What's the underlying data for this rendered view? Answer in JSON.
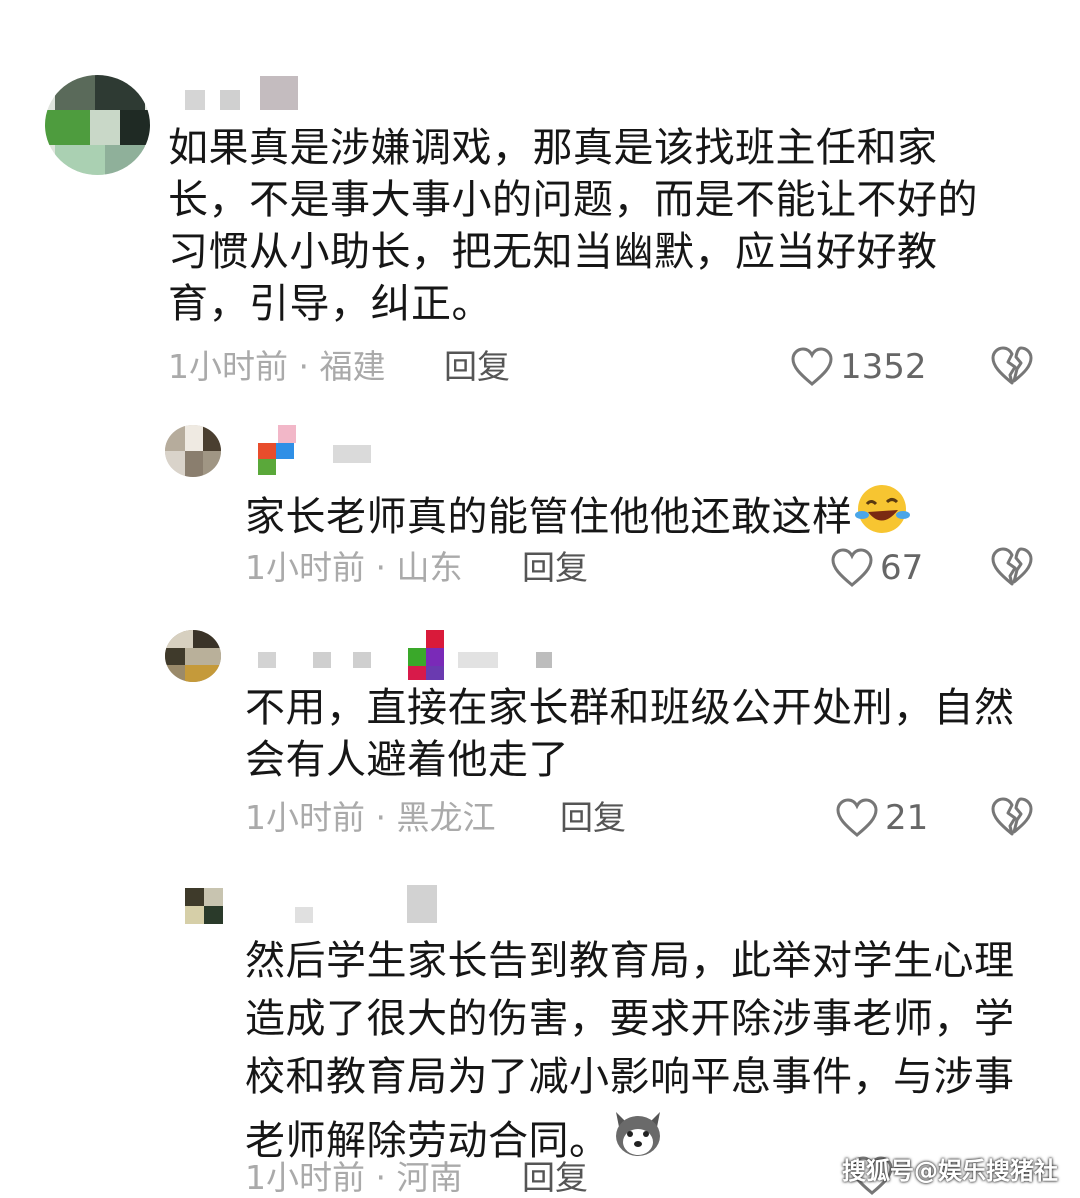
{
  "comments": [
    {
      "text": "如果真是涉嫌调戏，那真是该找班主任和家长，不是事大事小的问题，而是不能让不好的习惯从小助长，把无知当幽默，应当好好教育，引导，纠正。",
      "meta": "1小时前 · 福建",
      "reply": "回复",
      "likes": "1352"
    },
    {
      "text": "家长老师真的能管住他他还敢这样",
      "meta": "1小时前 · 山东",
      "reply": "回复",
      "likes": "67"
    },
    {
      "text": "不用，直接在家长群和班级公开处刑，自然会有人避着他走了",
      "meta": "1小时前 · 黑龙江",
      "reply": "回复",
      "likes": "21"
    },
    {
      "text": "然后学生家长告到教育局，此举对学生心理造成了很大的伤害，要求开除涉事老师，学校和教育局为了减小影响平息事件，与涉事老师解除劳动合同。",
      "meta": "1小时前 · 河南",
      "reply": "回复",
      "likes": ""
    }
  ],
  "watermark": "搜狐号@娱乐搜猪社",
  "icons": {
    "like": "heart-outline-icon",
    "dislike": "broken-heart-icon",
    "emoji_laugh": "laughing-tears-emoji",
    "emoji_dog": "husky-dog-emoji"
  },
  "colors": {
    "text": "#161616",
    "meta": "#aaaaaa",
    "reply": "#555555"
  }
}
